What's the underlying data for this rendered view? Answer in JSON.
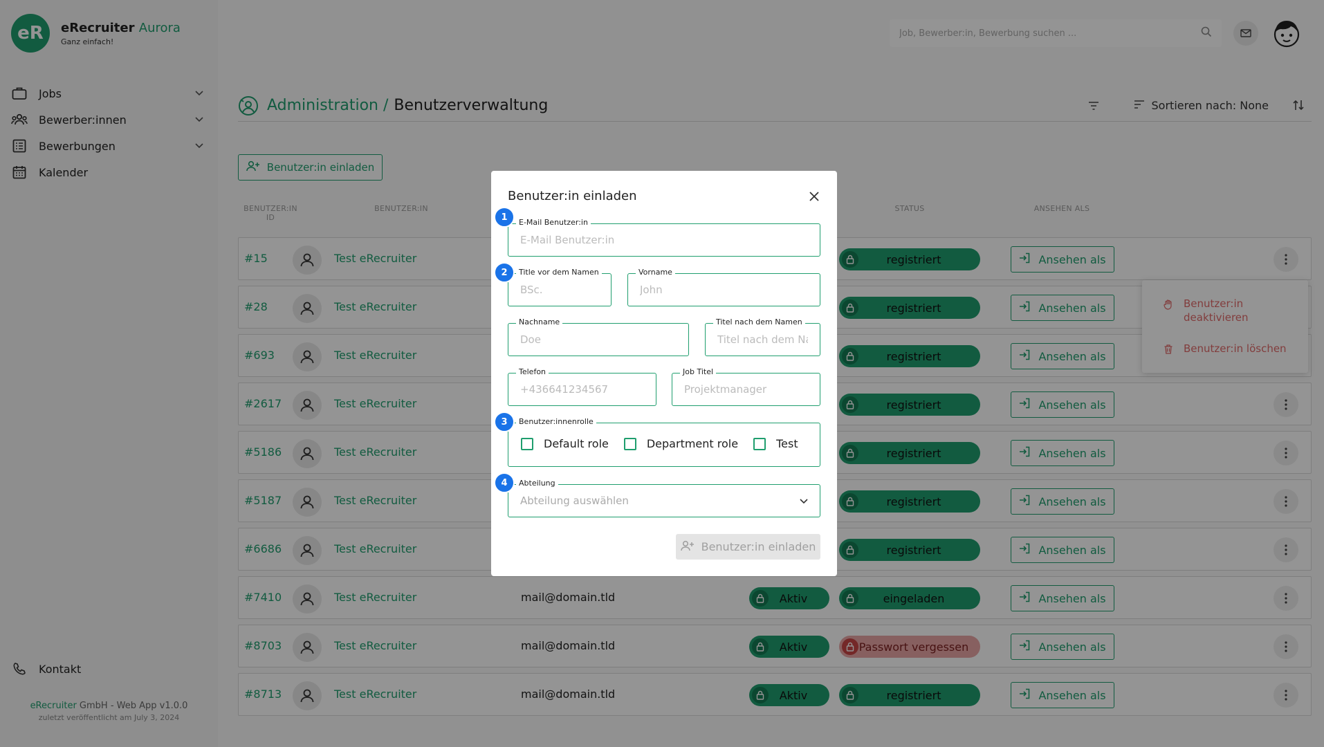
{
  "app": {
    "logo_mark": "eR",
    "name": "eRecruiter",
    "name_accent": "Aurora",
    "tagline": "Ganz einfach!"
  },
  "sidebar": {
    "items": [
      {
        "label": "Jobs",
        "icon": "briefcase-icon",
        "expandable": true
      },
      {
        "label": "Bewerber:innen",
        "icon": "users-icon",
        "expandable": true
      },
      {
        "label": "Bewerbungen",
        "icon": "list-icon",
        "expandable": true
      },
      {
        "label": "Kalender",
        "icon": "calendar-icon",
        "expandable": false
      }
    ],
    "contact_label": "Kontakt",
    "footer_brand": "eRecruiter",
    "footer_text": " GmbH - Web App v1.0.0",
    "footer_sub": "zuletzt veröffentlicht am July 3, 2024"
  },
  "header": {
    "search_placeholder": "Job, Bewerber:in, Bewerbung suchen ..."
  },
  "page": {
    "breadcrumb_parent": "Administration /",
    "breadcrumb_current": "Benutzerverwaltung",
    "sort_label": "Sortieren nach: None",
    "invite_button": "Benutzer:in einladen"
  },
  "table": {
    "columns": {
      "id_line1": "BENUTZER:IN",
      "id_line2": "ID",
      "user": "BENUTZER:IN",
      "status": "STATUS",
      "view_as": "ANSEHEN ALS"
    },
    "view_label": "Ansehen als",
    "rows": [
      {
        "id": "#15",
        "name": "Test eRecruiter",
        "email": "",
        "active": "",
        "status": "registriert",
        "status_type": "ok"
      },
      {
        "id": "#28",
        "name": "Test eRecruiter",
        "email": "",
        "active": "",
        "status": "registriert",
        "status_type": "ok"
      },
      {
        "id": "#693",
        "name": "Test eRecruiter",
        "email": "",
        "active": "",
        "status": "registriert",
        "status_type": "ok"
      },
      {
        "id": "#2617",
        "name": "Test eRecruiter",
        "email": "",
        "active": "",
        "status": "registriert",
        "status_type": "ok"
      },
      {
        "id": "#5186",
        "name": "Test eRecruiter",
        "email": "",
        "active": "",
        "status": "registriert",
        "status_type": "ok"
      },
      {
        "id": "#5187",
        "name": "Test eRecruiter",
        "email": "",
        "active": "",
        "status": "registriert",
        "status_type": "ok"
      },
      {
        "id": "#6686",
        "name": "Test eRecruiter",
        "email": "",
        "active": "",
        "status": "registriert",
        "status_type": "ok"
      },
      {
        "id": "#7410",
        "name": "Test eRecruiter",
        "email": "mail@domain.tld",
        "active": "Aktiv",
        "status": "eingeladen",
        "status_type": "ok"
      },
      {
        "id": "#8703",
        "name": "Test eRecruiter",
        "email": "mail@domain.tld",
        "active": "Aktiv",
        "status": "Passwort vergessen",
        "status_type": "warn"
      },
      {
        "id": "#8713",
        "name": "Test eRecruiter",
        "email": "mail@domain.tld",
        "active": "Aktiv",
        "status": "registriert",
        "status_type": "ok"
      }
    ]
  },
  "row_menu": {
    "deactivate_line1": "Benutzer:in",
    "deactivate_line2": "deaktivieren",
    "delete": "Benutzer:in löschen"
  },
  "modal": {
    "title": "Benutzer:in einladen",
    "steps": [
      "1",
      "2",
      "3",
      "4"
    ],
    "email": {
      "label": "E-Mail Benutzer:in",
      "placeholder": "E-Mail Benutzer:in",
      "value": ""
    },
    "title_before": {
      "label": "Title vor dem Namen",
      "placeholder": "BSc.",
      "value": ""
    },
    "first_name": {
      "label": "Vorname",
      "placeholder": "John",
      "value": ""
    },
    "last_name": {
      "label": "Nachname",
      "placeholder": "Doe",
      "value": ""
    },
    "title_after": {
      "label": "Titel nach dem Namen",
      "placeholder": "Titel nach dem Namen",
      "value": ""
    },
    "phone": {
      "label": "Telefon",
      "placeholder": "+436641234567",
      "value": ""
    },
    "job_title": {
      "label": "Job Titel",
      "placeholder": "Projektmanager",
      "value": ""
    },
    "roles": {
      "label": "Benutzer:innenrolle",
      "options": [
        "Default role",
        "Department role",
        "Test"
      ]
    },
    "department": {
      "label": "Abteilung",
      "placeholder": "Abteilung auswählen"
    },
    "submit": "Benutzer:in einladen"
  },
  "colors": {
    "accent": "#1f9e6e",
    "danger": "#e06a6a",
    "step": "#1a73e8"
  }
}
